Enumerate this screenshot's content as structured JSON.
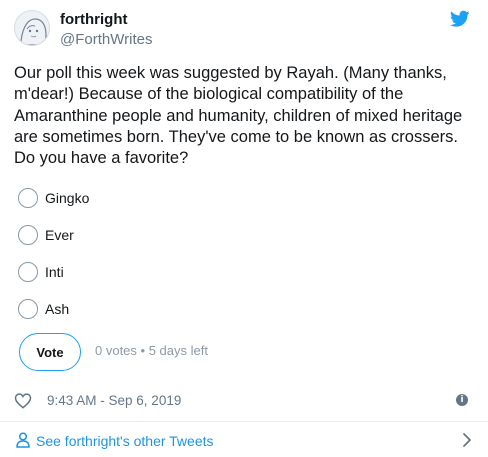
{
  "author": {
    "display_name": "forthright",
    "handle": "@ForthWrites"
  },
  "tweet": {
    "text": "Our poll this week was suggested by Rayah. (Many thanks, m'dear!) Because of the biological compatibility of the Amaranthine people and humanity, children of mixed heritage are sometimes born. They've come to be known as crossers. Do you have a favorite?"
  },
  "poll": {
    "options": [
      {
        "label": "Gingko"
      },
      {
        "label": "Ever"
      },
      {
        "label": "Inti"
      },
      {
        "label": "Ash"
      }
    ],
    "vote_label": "Vote",
    "meta": "0 votes • 5 days left"
  },
  "footer": {
    "timestamp": "9:43 AM - Sep 6, 2019",
    "info_glyph": "i"
  },
  "see_more": {
    "label": "See forthright's other Tweets"
  },
  "colors": {
    "twitter_blue": "#1da1f2",
    "link_blue": "#1b95e0",
    "secondary_text": "#657786"
  },
  "icons": [
    "avatar",
    "twitter-bird-icon",
    "heart-icon",
    "info-icon",
    "person-icon",
    "chevron-right-icon"
  ]
}
